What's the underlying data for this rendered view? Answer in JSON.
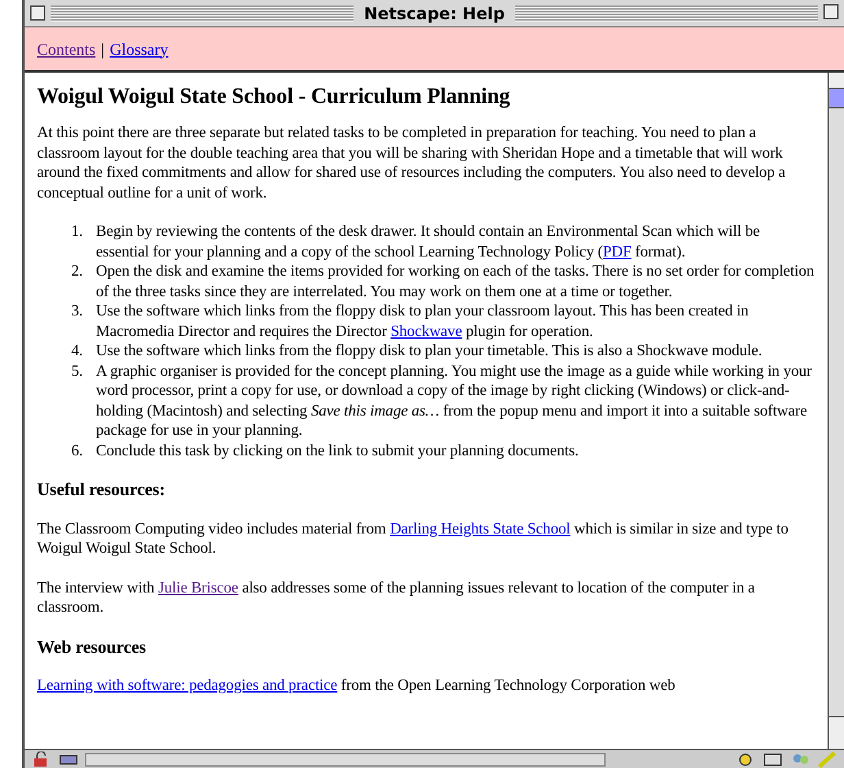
{
  "window": {
    "title": "Netscape: Help"
  },
  "nav_links": [
    {
      "label": "Contents",
      "visited": true
    },
    {
      "label": "Glossary",
      "visited": false
    }
  ],
  "nav_separator": "|",
  "heading": "Woigul Woigul State School - Curriculum Planning",
  "intro": "At this point there are three separate but related tasks to be completed in preparation for teaching. You need to plan a classroom layout for the double teaching area that you will be sharing with Sheridan Hope and a timetable that will work around the fixed commitments and allow for shared use of resources including the computers. You also need to develop a conceptual outline for a unit of work.",
  "steps": [
    {
      "number": "1.",
      "segments": [
        {
          "kind": "text",
          "text": "Begin by reviewing the contents of the desk drawer. It should contain an Environmental Scan which will be essential for your planning and a copy of the school Learning Technology Policy ("
        },
        {
          "kind": "link",
          "text": "PDF",
          "visited": false
        },
        {
          "kind": "text",
          "text": " format)."
        }
      ]
    },
    {
      "number": "2.",
      "segments": [
        {
          "kind": "text",
          "text": "Open the disk and examine the items provided for working on each of the tasks. There is no set order for completion of the three tasks since they are interrelated. You may work on them one at a time or together."
        }
      ]
    },
    {
      "number": "3.",
      "segments": [
        {
          "kind": "text",
          "text": "Use the software which links from the floppy disk to plan your classroom layout. This has been created in Macromedia Director and requires the Director "
        },
        {
          "kind": "link",
          "text": "Shockwave",
          "visited": false
        },
        {
          "kind": "text",
          "text": " plugin for operation."
        }
      ]
    },
    {
      "number": "4.",
      "segments": [
        {
          "kind": "text",
          "text": "Use the software which links from the floppy disk to plan your timetable. This is also a Shockwave module."
        }
      ]
    },
    {
      "number": "5.",
      "segments": [
        {
          "kind": "text",
          "text": "A graphic organiser is provided for the concept planning. You might use the image as a guide while working in your word processor, print a copy for use, or download a copy of the image by right clicking (Windows) or click-and-holding (Macintosh) and selecting *Save this image as…*   from the popup menu and import it into a suitable software package for use in your planning."
        }
      ]
    },
    {
      "number": "6.",
      "segments": [
        {
          "kind": "text",
          "text": "Conclude this task by clicking on the link to submit your planning documents."
        }
      ]
    }
  ],
  "sections": [
    {
      "kind": "heading",
      "text": "Useful resources:"
    },
    {
      "kind": "paragraph",
      "segments": [
        {
          "kind": "text",
          "text": "The Classroom Computing video includes material from "
        },
        {
          "kind": "link",
          "text": "Darling Heights State School",
          "visited": false
        },
        {
          "kind": "text",
          "text": " which is similar in size and type to Woigul Woigul State School."
        }
      ]
    },
    {
      "kind": "paragraph",
      "segments": [
        {
          "kind": "text",
          "text": "The interview with "
        },
        {
          "kind": "link",
          "text": "Julie Briscoe",
          "visited": true
        },
        {
          "kind": "text",
          "text": " also addresses some of the planning issues relevant to location of the computer in a classroom."
        }
      ]
    },
    {
      "kind": "heading",
      "text": "Web resources"
    },
    {
      "kind": "paragraph",
      "segments": [
        {
          "kind": "link",
          "text": "Learning with software: pedagogies and practice",
          "visited": false
        },
        {
          "kind": "text",
          "text": " from the Open Learning Technology Corporation web"
        }
      ]
    }
  ]
}
